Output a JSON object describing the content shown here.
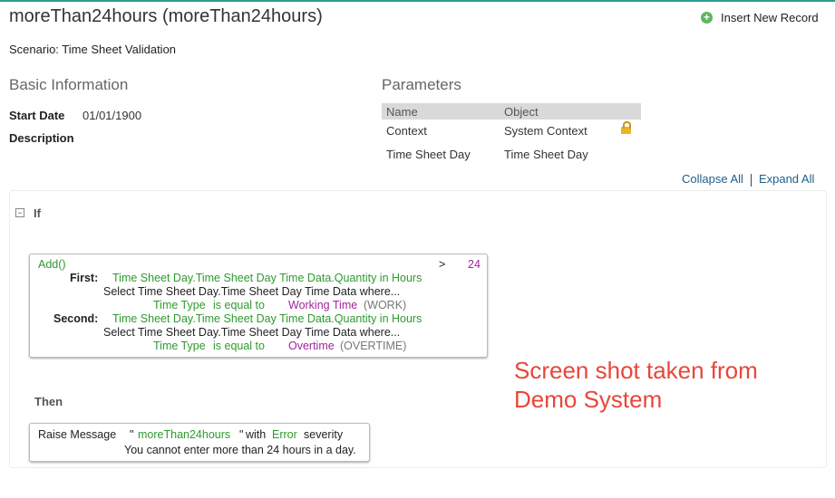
{
  "header": {
    "title": "moreThan24hours (moreThan24hours)",
    "insert_label": "Insert New Record",
    "scenario": "Scenario: Time Sheet Validation"
  },
  "basic": {
    "heading": "Basic Information",
    "start_date_label": "Start Date",
    "start_date_value": "01/01/1900",
    "description_label": "Description"
  },
  "parameters": {
    "heading": "Parameters",
    "columns": [
      "Name",
      "Object"
    ],
    "rows": [
      {
        "name": "Context",
        "object": "System Context",
        "locked": true
      },
      {
        "name": "Time Sheet Day",
        "object": "Time Sheet Day",
        "locked": false
      }
    ]
  },
  "controls": {
    "collapse_all": "Collapse All",
    "expand_all": "Expand All"
  },
  "rule": {
    "if_label": "If",
    "condition": {
      "func": "Add()",
      "operator": ">",
      "compare_value": "24",
      "first_label": "First:",
      "first_path": "Time Sheet Day.Time Sheet Day Time Data.Quantity in Hours",
      "first_select": "Select Time Sheet Day.Time Sheet Day Time Data where...",
      "first_filter_field": "Time Type",
      "first_filter_op": "is equal to",
      "first_filter_value": "Working Time",
      "first_filter_code": "(WORK)",
      "second_label": "Second:",
      "second_path": "Time Sheet Day.Time Sheet Day Time Data.Quantity in Hours",
      "second_select": "Select Time Sheet Day.Time Sheet Day Time Data where...",
      "second_filter_field": "Time Type",
      "second_filter_op": "is equal to",
      "second_filter_value": "Overtime",
      "second_filter_code": "(OVERTIME)"
    },
    "then_label": "Then",
    "action": {
      "type": "Raise Message",
      "quote_open": "\"",
      "message_id": "moreThan24hours",
      "quote_close": "\"",
      "with": "with",
      "severity": "Error",
      "severity_suffix": "severity",
      "message_text": "You cannot enter more than 24 hours in a day."
    }
  },
  "watermark": "Screen shot taken from Demo System",
  "colors": {
    "accent": "#2a9d8f",
    "green": "#2e9a2e",
    "purple": "#a0259f",
    "annotation": "#e8463a"
  }
}
